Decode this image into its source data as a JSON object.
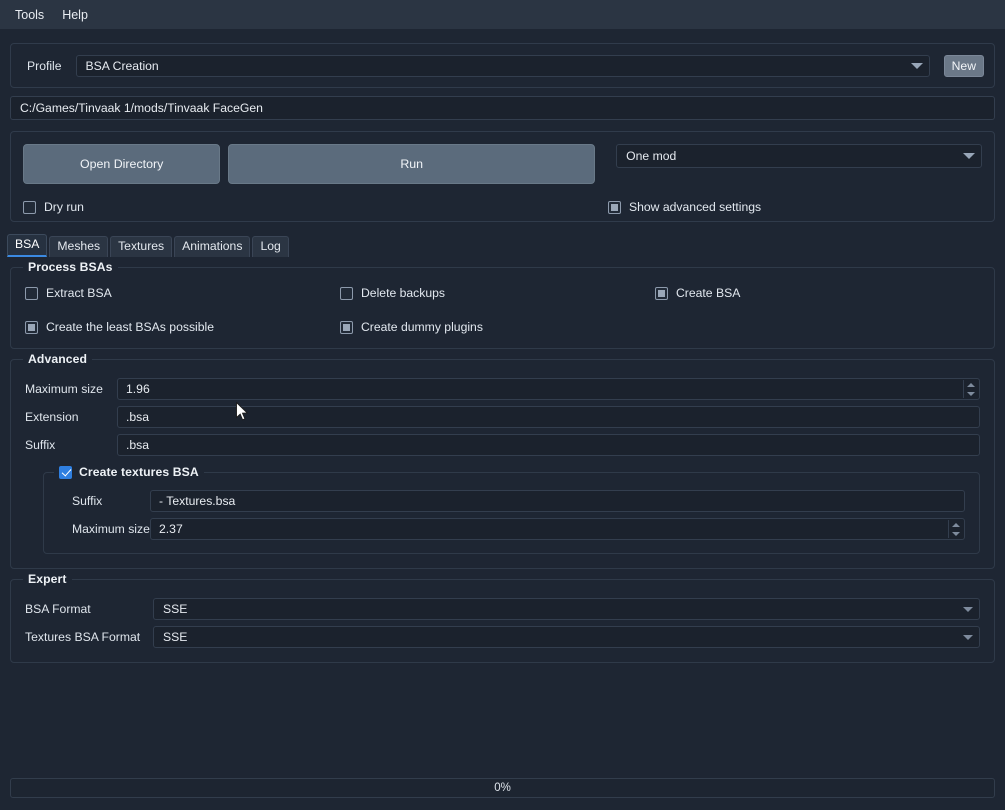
{
  "window": {
    "background_color": "#1e2633",
    "accent_color": "#3b8ae2"
  },
  "menubar": {
    "items": [
      {
        "label": "Tools"
      },
      {
        "label": "Help"
      }
    ]
  },
  "profile": {
    "label": "Profile",
    "value": "BSA Creation",
    "new_button": "New"
  },
  "path": {
    "value": "C:/Games/Tinvaak 1/mods/Tinvaak FaceGen"
  },
  "actions": {
    "open_directory": "Open Directory",
    "run": "Run",
    "mode": "One mod",
    "dry_run": {
      "label": "Dry run",
      "state": "unchecked"
    },
    "show_advanced": {
      "label": "Show advanced settings",
      "state": "partial"
    }
  },
  "tabs": [
    {
      "label": "BSA",
      "active": true
    },
    {
      "label": "Meshes",
      "active": false
    },
    {
      "label": "Textures",
      "active": false
    },
    {
      "label": "Animations",
      "active": false
    },
    {
      "label": "Log",
      "active": false
    }
  ],
  "process_bsas": {
    "title": "Process BSAs",
    "checkboxes": [
      {
        "label": "Extract BSA",
        "state": "unchecked"
      },
      {
        "label": "Delete backups",
        "state": "unchecked"
      },
      {
        "label": "Create BSA",
        "state": "partial"
      },
      {
        "label": "Create the least BSAs possible",
        "state": "partial"
      },
      {
        "label": "Create dummy plugins",
        "state": "partial"
      }
    ]
  },
  "advanced": {
    "title": "Advanced",
    "maximum_size": {
      "label": "Maximum size",
      "value": "1.96"
    },
    "extension": {
      "label": "Extension",
      "value": ".bsa"
    },
    "suffix": {
      "label": "Suffix",
      "value": ".bsa"
    },
    "textures_bsa": {
      "title": "Create textures BSA",
      "state": "checked",
      "suffix": {
        "label": "Suffix",
        "value": " - Textures.bsa"
      },
      "maximum_size": {
        "label": "Maximum size",
        "value": "2.37"
      }
    }
  },
  "expert": {
    "title": "Expert",
    "bsa_format": {
      "label": "BSA Format",
      "value": "SSE"
    },
    "textures_bsa_format": {
      "label": "Textures BSA Format",
      "value": "SSE"
    }
  },
  "progress": {
    "value": "0%"
  }
}
